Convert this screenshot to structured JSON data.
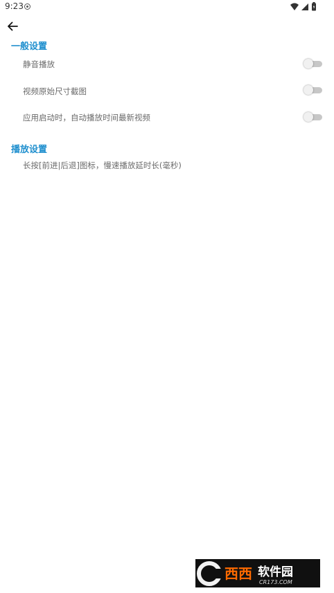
{
  "status_bar": {
    "time": "9:23"
  },
  "sections": {
    "general": {
      "title": "一般设置",
      "items": [
        {
          "label": "静音播放",
          "enabled": false
        },
        {
          "label": "视频原始尺寸截图",
          "enabled": false
        },
        {
          "label": "应用启动时，自动播放时间最新视频",
          "enabled": false
        }
      ]
    },
    "playback": {
      "title": "播放设置",
      "items": [
        {
          "label": "长按[前进|后退]图标，慢速播放延时长(毫秒)"
        }
      ]
    }
  },
  "watermark": {
    "brand": "西西软件园",
    "url": "CR173.COM"
  },
  "colors": {
    "accent": "#1f8fce",
    "toggle_track": "#c7c7c7",
    "toggle_thumb": "#f1f1f1"
  }
}
